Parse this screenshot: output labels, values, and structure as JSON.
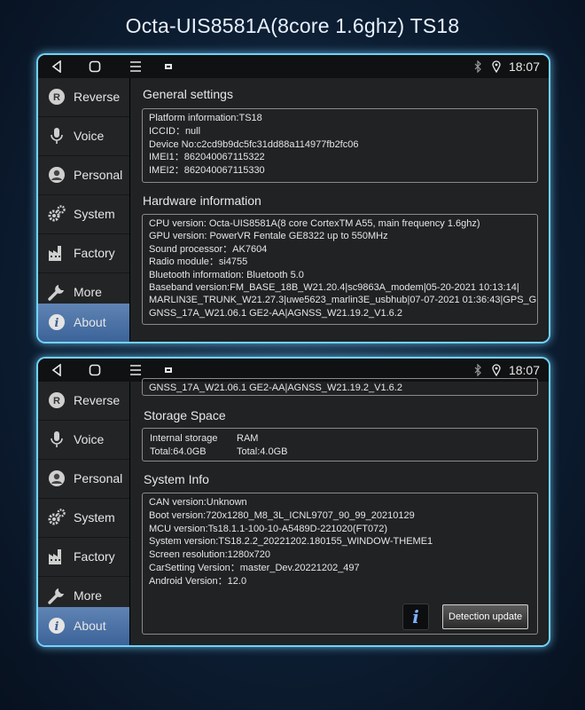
{
  "header": {
    "title": "Octa-UIS8581A(8core 1.6ghz) TS18"
  },
  "statusbar": {
    "time": "18:07",
    "icons": [
      "back-icon",
      "home-icon",
      "recents-icon",
      "notification-icon",
      "bluetooth-icon",
      "location-icon"
    ]
  },
  "sidebar": {
    "items": [
      {
        "label": "Reverse",
        "icon": "reverse-icon"
      },
      {
        "label": "Voice",
        "icon": "microphone-icon"
      },
      {
        "label": "Personal",
        "icon": "person-icon"
      },
      {
        "label": "System",
        "icon": "gears-icon"
      },
      {
        "label": "Factory",
        "icon": "factory-icon"
      },
      {
        "label": "More",
        "icon": "wrench-icon"
      },
      {
        "label": "About",
        "icon": "info-icon",
        "active": true
      }
    ]
  },
  "screen1": {
    "general_title": "General settings",
    "general_lines": [
      "Platform information:TS18",
      "ICCID：null",
      "Device No:c2cd9b9dc5fc31dd88a114977fb2fc06",
      "IMEI1：862040067115322",
      "IMEI2：862040067115330"
    ],
    "hardware_title": "Hardware information",
    "hardware_lines": [
      "CPU version: Octa-UIS8581A(8 core CortexTM A55, main frequency 1.6ghz)",
      "GPU version: PowerVR Fentale GE8322 up to 550MHz",
      "Sound processor：AK7604",
      "Radio module：si4755",
      "Bluetooth information: Bluetooth 5.0",
      "Baseband version:FM_BASE_18B_W21.20.4|sc9863A_modem|05-20-2021 10:13:14|",
      "MARLIN3E_TRUNK_W21.27.3|uwe5623_marlin3E_usbhub|07-07-2021 01:36:43|GPS_GLO",
      "GNSS_17A_W21.06.1 GE2-AA|AGNSS_W21.19.2_V1.6.2"
    ]
  },
  "screen2": {
    "top_line": "GNSS_17A_W21.06.1 GE2-AA|AGNSS_W21.19.2_V1.6.2",
    "storage_title": "Storage Space",
    "storage": {
      "internal_label": "Internal storage",
      "internal_total": "Total:64.0GB",
      "ram_label": "RAM",
      "ram_total": "Total:4.0GB"
    },
    "sysinfo_title": "System Info",
    "sysinfo_lines": [
      "CAN version:Unknown",
      "Boot version:720x1280_M8_3L_ICNL9707_90_99_20210129",
      "MCU version:Ts18.1.1-100-10-A5489D-221020(FT072)",
      "System version:TS18.2.2_20221202.180155_WINDOW-THEME1",
      "Screen resolution:1280x720",
      "CarSetting Version：master_Dev.20221202_497",
      "Android Version：12.0"
    ],
    "detection_button": "Detection update",
    "info_button_icon": "info-icon"
  },
  "colors": {
    "accent_glow": "#6fd3ff",
    "active_nav": "#4f76a8",
    "panel_bg": "#202224"
  }
}
